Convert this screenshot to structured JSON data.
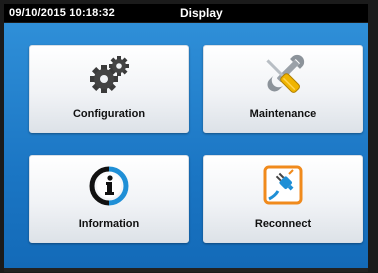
{
  "status_bar": {
    "datetime": "09/10/2015  10:18:32",
    "title": "Display"
  },
  "tiles": [
    {
      "label": "Configuration",
      "icon": "gears-icon"
    },
    {
      "label": "Maintenance",
      "icon": "wrench-screwdriver-icon"
    },
    {
      "label": "Information",
      "icon": "info-icon"
    },
    {
      "label": "Reconnect",
      "icon": "plug-icon"
    }
  ],
  "colors": {
    "background_top": "#2f8fd8",
    "background_bottom": "#136ab8",
    "status_bar": "#000000"
  }
}
